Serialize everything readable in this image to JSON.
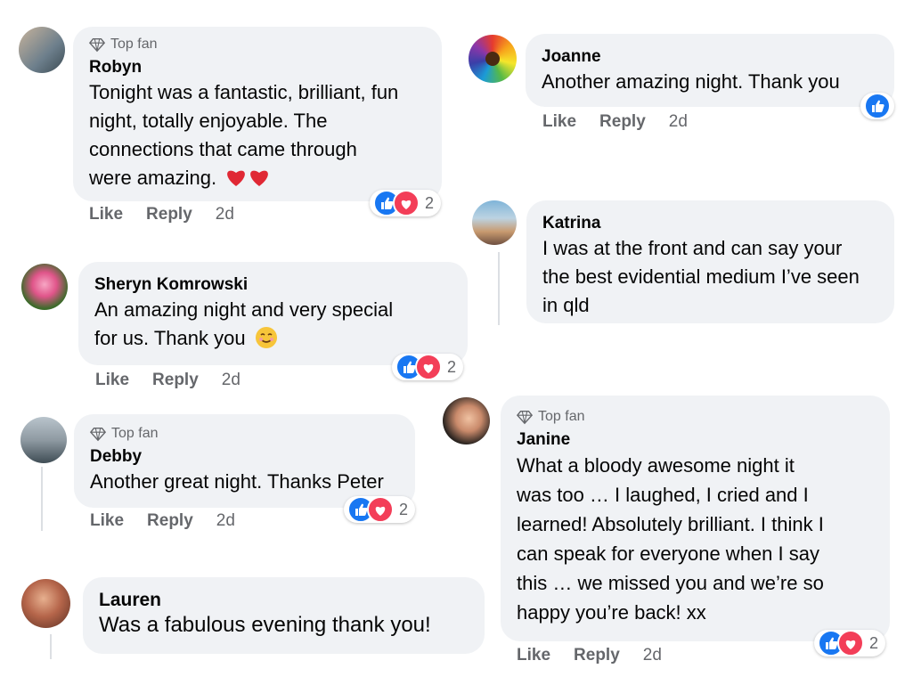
{
  "badge_label": "Top fan",
  "action_like": "Like",
  "action_reply": "Reply",
  "comments": {
    "robyn": {
      "author": "Robyn",
      "line1": "Tonight was a fantastic, brilliant, fun",
      "line2": "night, totally enjoyable. The",
      "line3": "connections that came through",
      "line4": "were amazing.",
      "time": "2d",
      "reactions": "2"
    },
    "sheryn": {
      "author": "Sheryn Komrowski",
      "line1": "An amazing night and very special",
      "line2": "for us. Thank you",
      "time": "2d",
      "reactions": "2"
    },
    "debby": {
      "author": "Debby",
      "line1": "Another great night. Thanks Peter",
      "time": "2d",
      "reactions": "2"
    },
    "lauren": {
      "author": "Lauren",
      "line1": "Was a fabulous evening thank you!"
    },
    "joanne": {
      "author": "Joanne",
      "line1": "Another amazing night. Thank you",
      "time": "2d"
    },
    "katrina": {
      "author": "Katrina",
      "line1": "I was at the front and can say your",
      "line2": "the best evidential medium I’ve seen",
      "line3": "in qld"
    },
    "janine": {
      "author": "Janine",
      "line1": "What a bloody awesome night it",
      "line2": "was too … I laughed, I cried and I",
      "line3": "learned! Absolutely brilliant. I think I",
      "line4": "can speak for everyone when I say",
      "line5": "this … we missed you and we’re so",
      "line6": "happy you’re back! xx",
      "time": "2d",
      "reactions": "2"
    }
  },
  "colors": {
    "bubble": "#f0f2f5",
    "like": "#1877f2",
    "love": "#f33e58",
    "meta": "#65676b"
  },
  "icons": [
    "diamond-icon",
    "like-reaction-icon",
    "love-reaction-icon",
    "heart-emoji",
    "smile-emoji"
  ]
}
